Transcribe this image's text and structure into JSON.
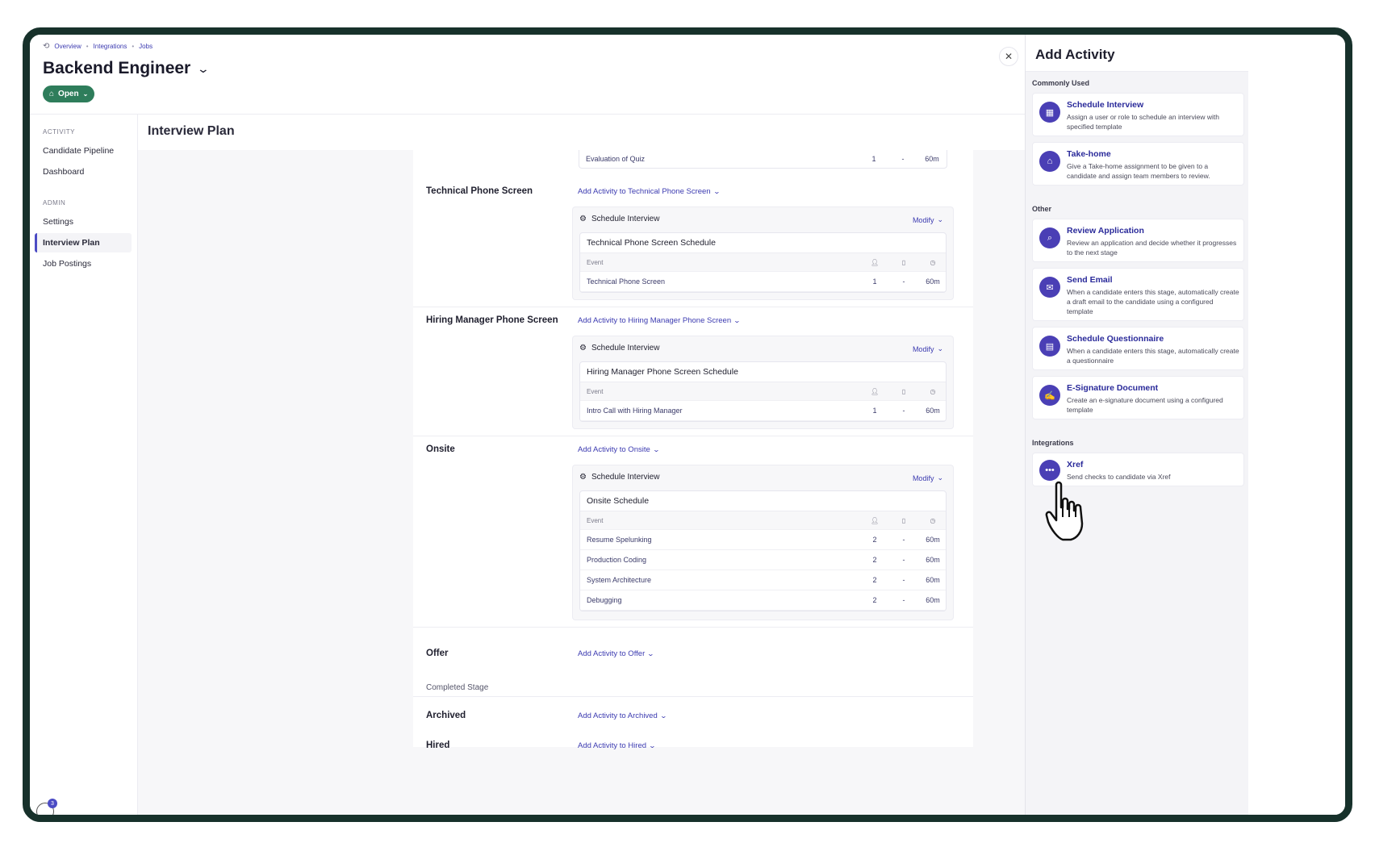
{
  "breadcrumb": {
    "items": [
      "Overview",
      "Integrations",
      "Jobs"
    ]
  },
  "job": {
    "title": "Backend Engineer",
    "status": "Open"
  },
  "nav": {
    "activity_section": "ACTIVITY",
    "activity_items": [
      "Candidate Pipeline",
      "Dashboard"
    ],
    "admin_section": "ADMIN",
    "admin_items": [
      "Settings",
      "Interview Plan",
      "Job Postings"
    ],
    "active_item": "Interview Plan",
    "notification_count": "3"
  },
  "main": {
    "title": "Interview Plan",
    "top_row": {
      "event": "Evaluation of Quiz",
      "count": "1",
      "dash": "-",
      "duration": "60m"
    },
    "event_header": "Event",
    "activity_label": "Schedule Interview",
    "modify_label": "Modify",
    "stages": [
      {
        "name": "Technical Phone Screen",
        "add_link": "Add Activity to Technical Phone Screen",
        "schedule_title": "Technical Phone Screen Schedule",
        "events": [
          {
            "event": "Technical Phone Screen",
            "count": "1",
            "dash": "-",
            "duration": "60m"
          }
        ]
      },
      {
        "name": "Hiring Manager Phone Screen",
        "add_link": "Add Activity to Hiring Manager Phone Screen",
        "schedule_title": "Hiring Manager Phone Screen Schedule",
        "events": [
          {
            "event": "Intro Call with Hiring Manager",
            "count": "1",
            "dash": "-",
            "duration": "60m"
          }
        ]
      },
      {
        "name": "Onsite",
        "add_link": "Add Activity to Onsite",
        "schedule_title": "Onsite Schedule",
        "events": [
          {
            "event": "Resume Spelunking",
            "count": "2",
            "dash": "-",
            "duration": "60m"
          },
          {
            "event": "Production Coding",
            "count": "2",
            "dash": "-",
            "duration": "60m"
          },
          {
            "event": "System Architecture",
            "count": "2",
            "dash": "-",
            "duration": "60m"
          },
          {
            "event": "Debugging",
            "count": "2",
            "dash": "-",
            "duration": "60m"
          }
        ]
      },
      {
        "name": "Offer",
        "add_link": "Add Activity to Offer"
      }
    ],
    "completed_label": "Completed Stage",
    "completed_stages": [
      {
        "name": "Archived",
        "add_link": "Add Activity to Archived"
      },
      {
        "name": "Hired",
        "add_link": "Add Activity to Hired"
      }
    ]
  },
  "drawer": {
    "title": "Add Activity",
    "close_icon": "close-icon",
    "sections": {
      "common": "Commonly Used",
      "other": "Other",
      "integrations": "Integrations"
    },
    "common_items": [
      {
        "title": "Schedule Interview",
        "desc": "Assign a user or role to schedule an interview with specified template",
        "icon": "calendar-icon"
      },
      {
        "title": "Take-home",
        "desc": "Give a Take-home assignment to be given to a candidate and assign team members to review.",
        "icon": "home-icon"
      }
    ],
    "other_items": [
      {
        "title": "Review Application",
        "desc": "Review an application and decide whether it progresses to the next stage",
        "icon": "search-icon"
      },
      {
        "title": "Send Email",
        "desc": "When a candidate enters this stage, automatically create a draft email to the candidate using a configured template",
        "icon": "envelope-icon"
      },
      {
        "title": "Schedule Questionnaire",
        "desc": "When a candidate enters this stage, automatically create a questionnaire",
        "icon": "clipboard-icon"
      },
      {
        "title": "E-Signature Document",
        "desc": "Create an e-signature document using a configured template",
        "icon": "signature-icon"
      }
    ],
    "integration_items": [
      {
        "title": "Xref",
        "desc": "Send checks to candidate via Xref",
        "icon": "xref-logo-icon"
      }
    ]
  },
  "colors": {
    "frame": "#17312b",
    "accent": "#3b3ab0",
    "status_green": "#2e7d5b",
    "icon_purple": "#4a3fb5"
  }
}
